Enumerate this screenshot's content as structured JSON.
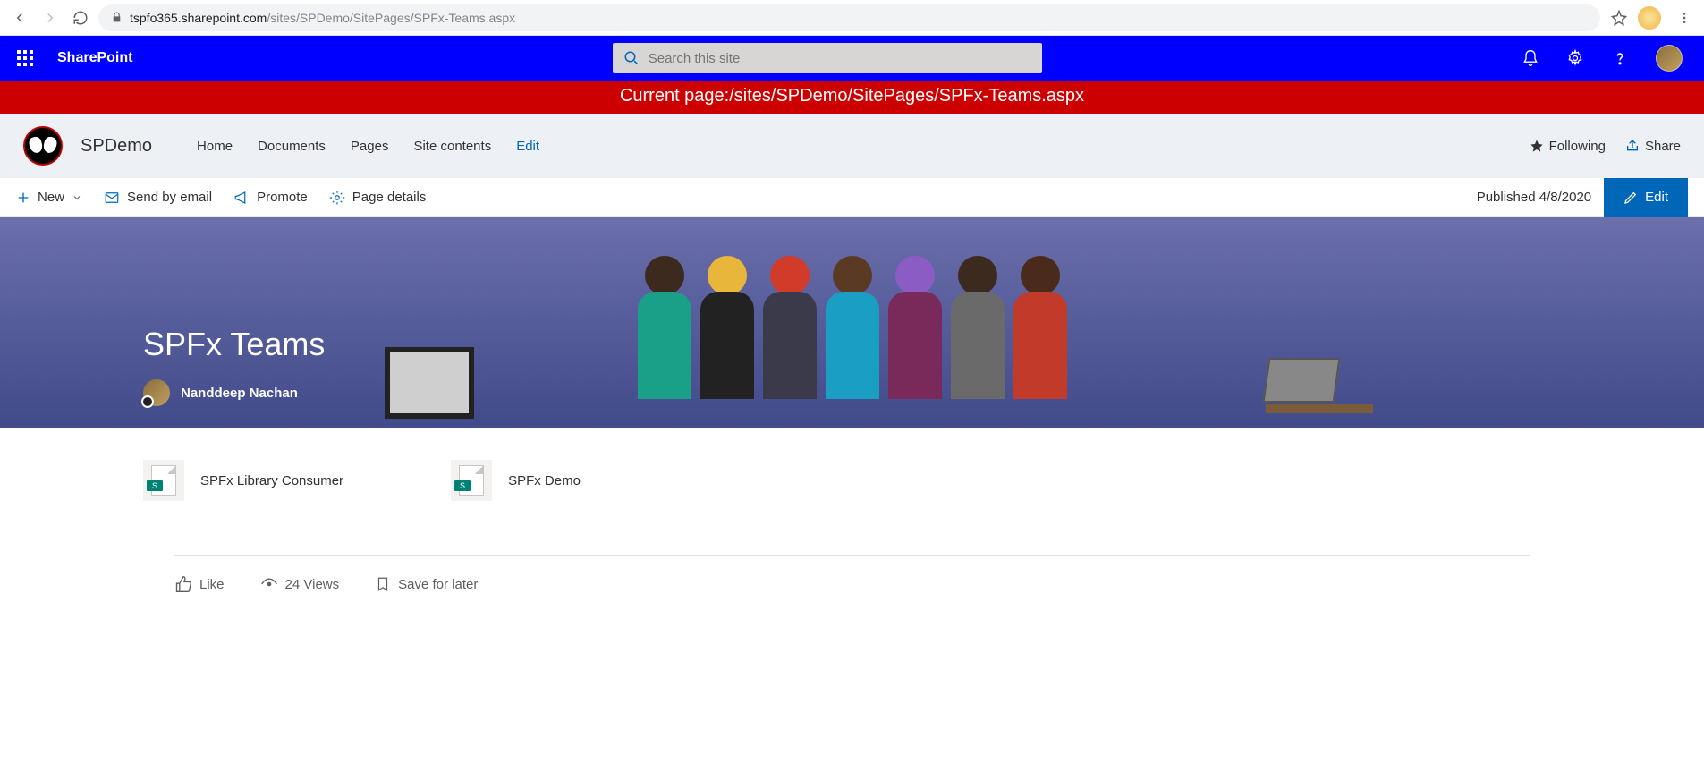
{
  "browser": {
    "url_host": "tspfo365.sharepoint.com",
    "url_path": "/sites/SPDemo/SitePages/SPFx-Teams.aspx"
  },
  "suite": {
    "brand": "SharePoint",
    "search_placeholder": "Search this site"
  },
  "banner": {
    "text": "Current page:/sites/SPDemo/SitePages/SPFx-Teams.aspx"
  },
  "site": {
    "name": "SPDemo",
    "nav": {
      "home": "Home",
      "documents": "Documents",
      "pages": "Pages",
      "site_contents": "Site contents",
      "edit": "Edit"
    },
    "following": "Following",
    "share": "Share"
  },
  "commandbar": {
    "new": "New",
    "send_by_email": "Send by email",
    "promote": "Promote",
    "page_details": "Page details",
    "published": "Published 4/8/2020",
    "edit": "Edit"
  },
  "hero": {
    "title": "SPFx Teams",
    "author": "Nanddeep Nachan"
  },
  "links": {
    "item1": "SPFx Library Consumer",
    "item2": "SPFx Demo",
    "badge": "S"
  },
  "social": {
    "like": "Like",
    "views": "24 Views",
    "save": "Save for later"
  }
}
